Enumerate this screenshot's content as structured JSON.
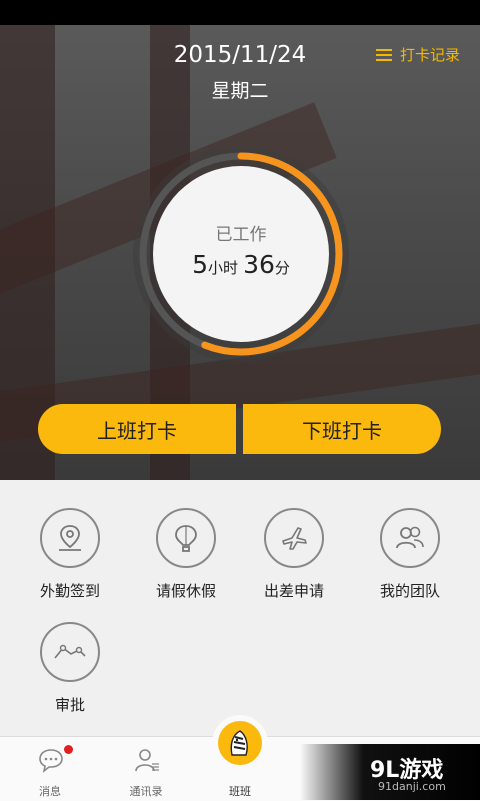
{
  "header": {
    "date": "2015/11/24",
    "weekday": "星期二",
    "record_label": "打卡记录"
  },
  "work_timer": {
    "label": "已工作",
    "hours": "5",
    "hours_unit": "小时",
    "minutes": "36",
    "minutes_unit": "分",
    "progress_fraction": 0.56
  },
  "actions": {
    "clock_in": "上班打卡",
    "clock_out": "下班打卡"
  },
  "features": [
    {
      "label": "外勤签到",
      "icon": "location-pin-icon"
    },
    {
      "label": "请假休假",
      "icon": "hot-air-balloon-icon"
    },
    {
      "label": "出差申请",
      "icon": "airplane-icon"
    },
    {
      "label": "我的团队",
      "icon": "team-icon"
    },
    {
      "label": "审批",
      "icon": "approval-trend-icon"
    }
  ],
  "tabbar": {
    "items": [
      {
        "label": "消息",
        "icon": "chat-bubble-icon",
        "badge": true
      },
      {
        "label": "通讯录",
        "icon": "contacts-icon"
      },
      {
        "label": "班班",
        "icon": "zebra-avatar-icon",
        "active": true
      }
    ]
  },
  "watermark": {
    "brand": "9L游戏",
    "url": "91danji.com"
  },
  "colors": {
    "accent": "#fbb90e",
    "progress": "#f7941d",
    "badge": "#e02020"
  }
}
